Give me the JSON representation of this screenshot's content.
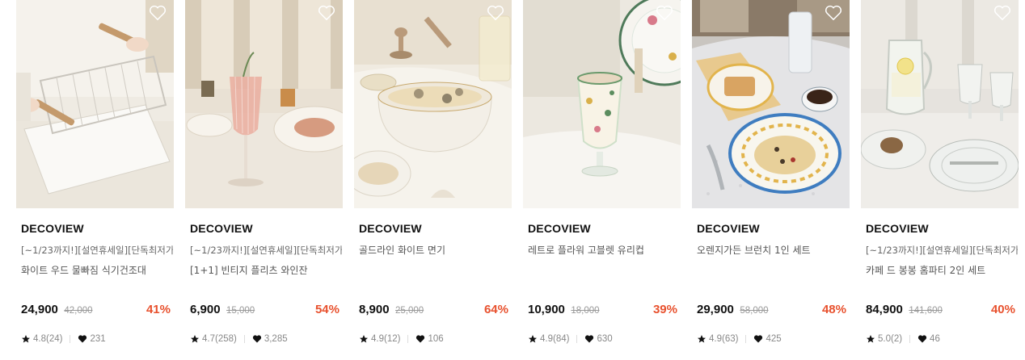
{
  "products": [
    {
      "brand": "DECOVIEW",
      "promo": "[~1/23까지!][설연휴세일][단독최저가]",
      "name": "화이트 우드 물빠짐 식기건조대",
      "price": "24,900",
      "original_price": "42,000",
      "discount": "41%",
      "rating": "4.8(24)",
      "likes": "231",
      "image_icon": "dish-rack-photo"
    },
    {
      "brand": "DECOVIEW",
      "promo": "[~1/23까지!][설연휴세일][단독최저가]",
      "name": "[1+1] 빈티지 플리츠 와인잔",
      "price": "6,900",
      "original_price": "15,000",
      "discount": "54%",
      "rating": "4.7(258)",
      "likes": "3,285",
      "image_icon": "wine-glass-photo"
    },
    {
      "brand": "DECOVIEW",
      "promo": "",
      "name": "골드라인 화이트 면기",
      "price": "8,900",
      "original_price": "25,000",
      "discount": "64%",
      "rating": "4.9(12)",
      "likes": "106",
      "image_icon": "pasta-bowl-photo"
    },
    {
      "brand": "DECOVIEW",
      "promo": "",
      "name": "레트로 플라워 고블렛 유리컵",
      "price": "10,900",
      "original_price": "18,000",
      "discount": "39%",
      "rating": "4.9(84)",
      "likes": "630",
      "image_icon": "goblet-photo"
    },
    {
      "brand": "DECOVIEW",
      "promo": "",
      "name": "오렌지가든 브런치 1인 세트",
      "price": "29,900",
      "original_price": "58,000",
      "discount": "48%",
      "rating": "4.9(63)",
      "likes": "425",
      "image_icon": "brunch-set-photo"
    },
    {
      "brand": "DECOVIEW",
      "promo": "[~1/23까지!][설연휴세일][단독최저가]",
      "name": "카페 드 봉봉 홈파티 2인 세트",
      "price": "84,900",
      "original_price": "141,600",
      "discount": "40%",
      "rating": "5.0(2)",
      "likes": "46",
      "image_icon": "cafe-set-photo"
    }
  ],
  "colors": {
    "discount": "#e8512e",
    "text": "#111111",
    "muted": "#999999"
  },
  "icons": {
    "wishlist": "heart-outline-icon",
    "rating": "star-icon",
    "likes": "heart-icon"
  }
}
